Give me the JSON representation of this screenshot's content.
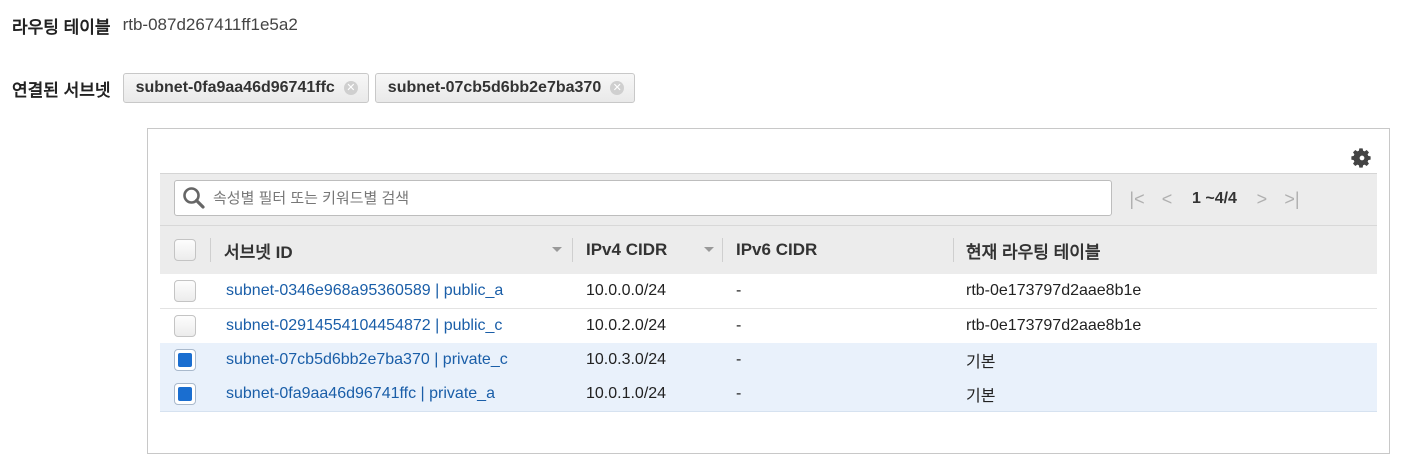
{
  "route_table": {
    "label": "라우팅 테이블",
    "value": "rtb-087d267411ff1e5a2"
  },
  "associated_subnets": {
    "label": "연결된 서브넷",
    "chips": [
      {
        "label": "subnet-0fa9aa46d96741ffc",
        "remove": "⊗"
      },
      {
        "label": "subnet-07cb5d6bb2e7ba370",
        "remove": "⊗"
      }
    ]
  },
  "search": {
    "placeholder": "속성별 필터 또는 키워드별 검색"
  },
  "pagination": {
    "text": "1 ~4/4"
  },
  "table": {
    "columns": [
      "서브넷 ID",
      "IPv4 CIDR",
      "IPv6 CIDR",
      "현재 라우팅 테이블"
    ],
    "rows": [
      {
        "checked": false,
        "subnet": "subnet-0346e968a95360589 | public_a",
        "ipv4": "10.0.0.0/24",
        "ipv6": "-",
        "route_table": "rtb-0e173797d2aae8b1e"
      },
      {
        "checked": false,
        "subnet": "subnet-02914554104454872 | public_c",
        "ipv4": "10.0.2.0/24",
        "ipv6": "-",
        "route_table": "rtb-0e173797d2aae8b1e"
      },
      {
        "checked": true,
        "subnet": "subnet-07cb5d6bb2e7ba370 | private_c",
        "ipv4": "10.0.3.0/24",
        "ipv6": "-",
        "route_table": "기본"
      },
      {
        "checked": true,
        "subnet": "subnet-0fa9aa46d96741ffc | private_a",
        "ipv4": "10.0.1.0/24",
        "ipv6": "-",
        "route_table": "기본"
      }
    ]
  },
  "colors": {
    "link": "#1a5ea8",
    "checkbox_selected": "#1a6ed0",
    "row_selected_bg": "#e9f1fb"
  }
}
